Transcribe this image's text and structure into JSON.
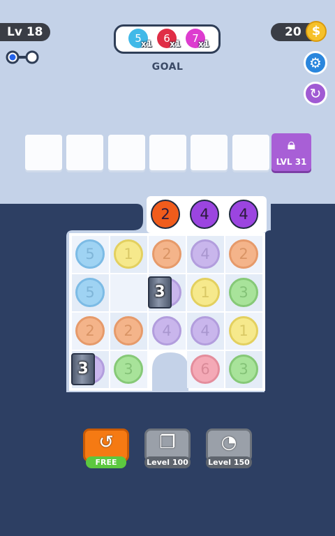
{
  "header": {
    "level": "Lv 18",
    "coins": "20",
    "coin_symbol": "$",
    "goal_label": "GOAL",
    "goals": [
      {
        "number": "5",
        "count": "x1",
        "color": "#41b9e8"
      },
      {
        "number": "6",
        "count": "x1",
        "color": "#e02d46"
      },
      {
        "number": "7",
        "count": "x1",
        "color": "#dd3ccf"
      }
    ]
  },
  "icons": {
    "settings": "gear-icon",
    "restart": "restart-icon",
    "level_progress": "toggle-progress-icon"
  },
  "slots": {
    "empty_count": 6,
    "locked_label": "LVL 31"
  },
  "queue": [
    {
      "number": "2",
      "color": "#f05c1c"
    },
    {
      "number": "4",
      "color": "#9b45e0"
    },
    {
      "number": "4",
      "color": "#9b45e0"
    }
  ],
  "board": {
    "rows": [
      [
        {
          "number": "5",
          "color": "blue"
        },
        {
          "number": "1",
          "color": "yellow"
        },
        {
          "number": "2",
          "color": "orange"
        },
        {
          "number": "4",
          "color": "purple"
        },
        {
          "number": "2",
          "color": "orange"
        }
      ],
      [
        {
          "number": "5",
          "color": "blue"
        },
        null,
        {
          "number": "",
          "color": "purple"
        },
        {
          "number": "1",
          "color": "yellow"
        },
        {
          "number": "3",
          "color": "green"
        }
      ],
      [
        {
          "number": "2",
          "color": "orange"
        },
        {
          "number": "2",
          "color": "orange"
        },
        {
          "number": "4",
          "color": "purple"
        },
        {
          "number": "4",
          "color": "purple"
        },
        {
          "number": "1",
          "color": "yellow"
        }
      ],
      [
        {
          "number": "",
          "color": "purple"
        },
        {
          "number": "3",
          "color": "green"
        },
        null,
        {
          "number": "6",
          "color": "pink"
        },
        {
          "number": "3",
          "color": "green"
        }
      ]
    ],
    "blockers": [
      {
        "label": "3",
        "row": 1,
        "col": 2
      },
      {
        "label": "3",
        "row": 3,
        "col": 0
      }
    ]
  },
  "boosters": [
    {
      "label": "FREE",
      "icon": "undo-icon"
    },
    {
      "label": "Level 100",
      "icon": "shuffle-icon"
    },
    {
      "label": "Level 150",
      "icon": "bomb-icon"
    }
  ],
  "colors": {
    "top_bg": "#c4d2e8",
    "bottom_bg": "#2d3f63",
    "blue": "#9fd3f3",
    "yellow": "#f6e98c",
    "orange": "#f4b48a",
    "purple": "#c9b6ec",
    "green": "#a8e39a",
    "pink": "#f4a9b6"
  }
}
